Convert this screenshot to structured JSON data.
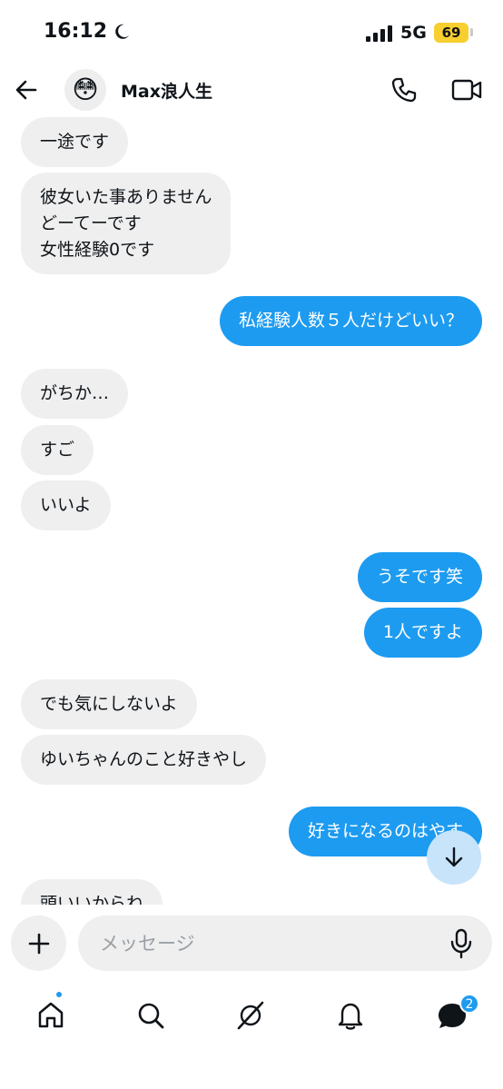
{
  "status_bar": {
    "time": "16:12",
    "network": "5G",
    "battery": "69"
  },
  "header": {
    "avatar_emoji": "😳",
    "contact_name": "Max浪人生"
  },
  "messages": [
    {
      "from": "them",
      "text": "一途です"
    },
    {
      "from": "them",
      "text": "彼女いた事ありません\nどーてーです\n女性経験0です"
    },
    {
      "from": "me",
      "text": "私経験人数５人だけどいい？"
    },
    {
      "from": "them",
      "text": "がちか…"
    },
    {
      "from": "them",
      "text": "すご"
    },
    {
      "from": "them",
      "text": "いいよ"
    },
    {
      "from": "me",
      "text": "うそです笑"
    },
    {
      "from": "me",
      "text": "1人ですよ"
    },
    {
      "from": "them",
      "text": "でも気にしないよ"
    },
    {
      "from": "them",
      "text": "ゆいちゃんのこと好きやし"
    },
    {
      "from": "me",
      "text": "好きになるのはやす"
    },
    {
      "from": "them",
      "text": "頭いいからね"
    }
  ],
  "composer": {
    "placeholder": "メッセージ"
  },
  "tab_bar": {
    "items": [
      {
        "icon": "home-icon",
        "has_dot": true
      },
      {
        "icon": "search-icon"
      },
      {
        "icon": "grok-icon"
      },
      {
        "icon": "bell-icon"
      },
      {
        "icon": "messages-icon",
        "badge": "2"
      }
    ]
  },
  "colors": {
    "accent": "#1d9bf0",
    "incoming_bubble": "#efefef",
    "battery": "#f7cf2f"
  }
}
